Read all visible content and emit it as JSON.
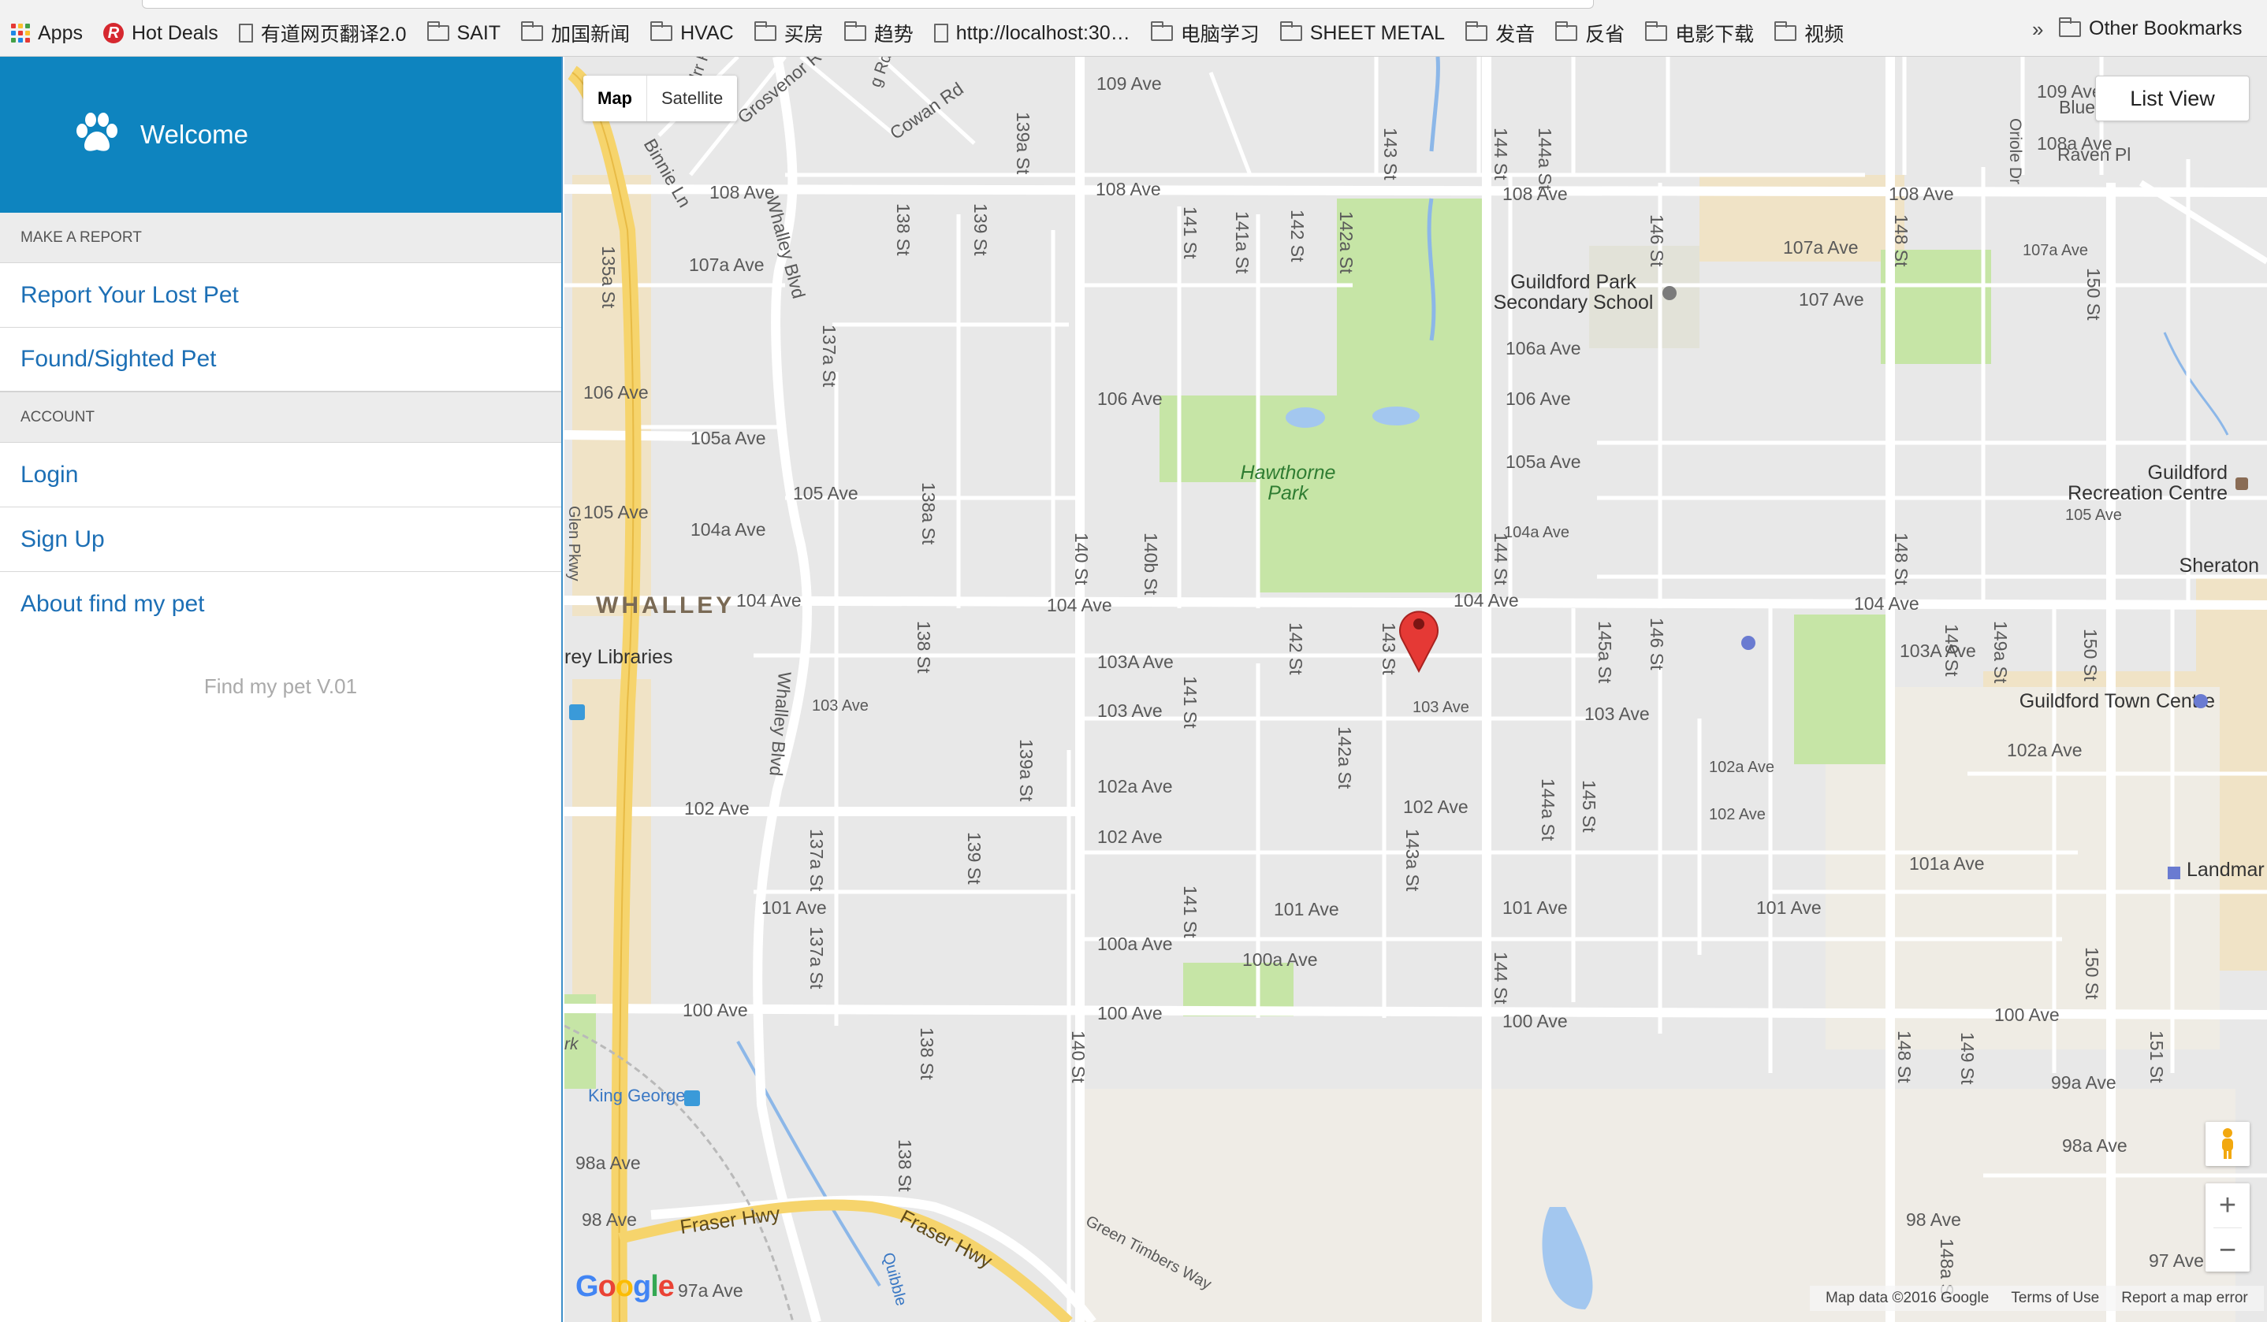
{
  "bookmarks": {
    "items": [
      {
        "label": "Apps",
        "icon": "apps-grid-icon"
      },
      {
        "label": "Hot Deals",
        "icon": "hot-deals-icon"
      },
      {
        "label": "有道网页翻译2.0",
        "icon": "page-icon"
      },
      {
        "label": "SAIT",
        "icon": "folder-icon"
      },
      {
        "label": "加国新闻",
        "icon": "folder-icon"
      },
      {
        "label": "HVAC",
        "icon": "folder-icon"
      },
      {
        "label": "买房",
        "icon": "folder-icon"
      },
      {
        "label": "趋势",
        "icon": "folder-icon"
      },
      {
        "label": "http://localhost:30…",
        "icon": "page-icon"
      },
      {
        "label": "电脑学习",
        "icon": "folder-icon"
      },
      {
        "label": "SHEET METAL",
        "icon": "folder-icon"
      },
      {
        "label": "发音",
        "icon": "folder-icon"
      },
      {
        "label": "反省",
        "icon": "folder-icon"
      },
      {
        "label": "电影下载",
        "icon": "folder-icon"
      },
      {
        "label": "视频",
        "icon": "folder-icon"
      }
    ],
    "more": "»",
    "other": "Other Bookmarks"
  },
  "sidebar": {
    "title": "Welcome",
    "sections": {
      "report": "MAKE A REPORT",
      "account": "ACCOUNT"
    },
    "report_lost": "Report Your Lost Pet",
    "found_sighted": "Found/Sighted Pet",
    "login": "Login",
    "signup": "Sign Up",
    "about": "About find my pet",
    "version": "Find my pet V.01",
    "accent_color": "#0e84bf"
  },
  "map": {
    "type_map": "Map",
    "type_satellite": "Satellite",
    "list_view": "List View",
    "zoom_in": "+",
    "zoom_out": "−",
    "google": [
      "G",
      "o",
      "o",
      "g",
      "l",
      "e"
    ],
    "attribution": {
      "data": "Map data ©2016 Google",
      "terms": "Terms of Use",
      "report": "Report a map error"
    },
    "district": "WHALLEY",
    "parks": [
      "Hawthorne",
      "Park"
    ],
    "school": [
      "Guildford Park",
      "Secondary School"
    ],
    "recreation": [
      "Guildford",
      "Recreation Centre"
    ],
    "poi": {
      "sheraton": "Sheraton",
      "town_centre": "Guildford Town Centre",
      "landmark": "Landmar",
      "libraries": "rey Libraries",
      "king_george": "King George",
      "blue": "Blue"
    },
    "highways": [
      "Fraser Hwy",
      "Fraser Hwy",
      "Green Timbers Way",
      "Quibble"
    ],
    "avenues": [
      "109 Ave",
      "109 Ave",
      "108a Ave",
      "108 Ave",
      "108 Ave",
      "108 Ave",
      "108 Ave",
      "107a Ave",
      "107a Ave",
      "107a Ave",
      "107 Ave",
      "106a Ave",
      "106 Ave",
      "106 Ave",
      "106 Ave",
      "105a Ave",
      "105a Ave",
      "105 Ave",
      "105 Ave",
      "105 Ave",
      "104a Ave",
      "104a Ave",
      "104 Ave",
      "104 Ave",
      "104 Ave",
      "104 Ave",
      "103A Ave",
      "103A Ave",
      "103 Ave",
      "103 Ave",
      "103 Ave",
      "103 Ave",
      "102a Ave",
      "102a Ave",
      "102a Ave",
      "102 Ave",
      "102 Ave",
      "102 Ave",
      "102 Ave",
      "101a Ave",
      "101 Ave",
      "101 Ave",
      "101 Ave",
      "101 Ave",
      "100a Ave",
      "100a Ave",
      "100 Ave",
      "100 Ave",
      "100 Ave",
      "100 Ave",
      "99a Ave",
      "98a Ave",
      "98a Ave",
      "98 Ave",
      "98 Ave",
      "97a Ave",
      "97 Ave",
      "Raven Pl"
    ],
    "streets": [
      "135a St",
      "137a St",
      "137a St",
      "137a St",
      "138 St",
      "138a St",
      "138 St",
      "138 St",
      "138 St",
      "139 St",
      "139 St",
      "139a St",
      "139a St",
      "140 St",
      "140 St",
      "140b St",
      "141 St",
      "141 St",
      "141 St",
      "141a St",
      "142 St",
      "142 St",
      "142a St",
      "142a St",
      "143 St",
      "143 St",
      "143a St",
      "144 St",
      "144 St",
      "144 St",
      "144a St",
      "144a St",
      "145a St",
      "145 St",
      "146 St",
      "146 St",
      "148 St",
      "148 St",
      "148 St",
      "148a St",
      "149 St",
      "149 St",
      "149a St",
      "150 St",
      "150 St",
      "150 St",
      "151 St",
      "Whalley Blvd",
      "Whalley Blvd",
      "Grosvenor Rd",
      "Cowan Rd",
      "Binnie Ln",
      "Oriole Dr",
      "Glen Pkwy",
      "rk",
      "lrr Rd",
      "g Rd"
    ],
    "marker_color": "#e53935"
  }
}
